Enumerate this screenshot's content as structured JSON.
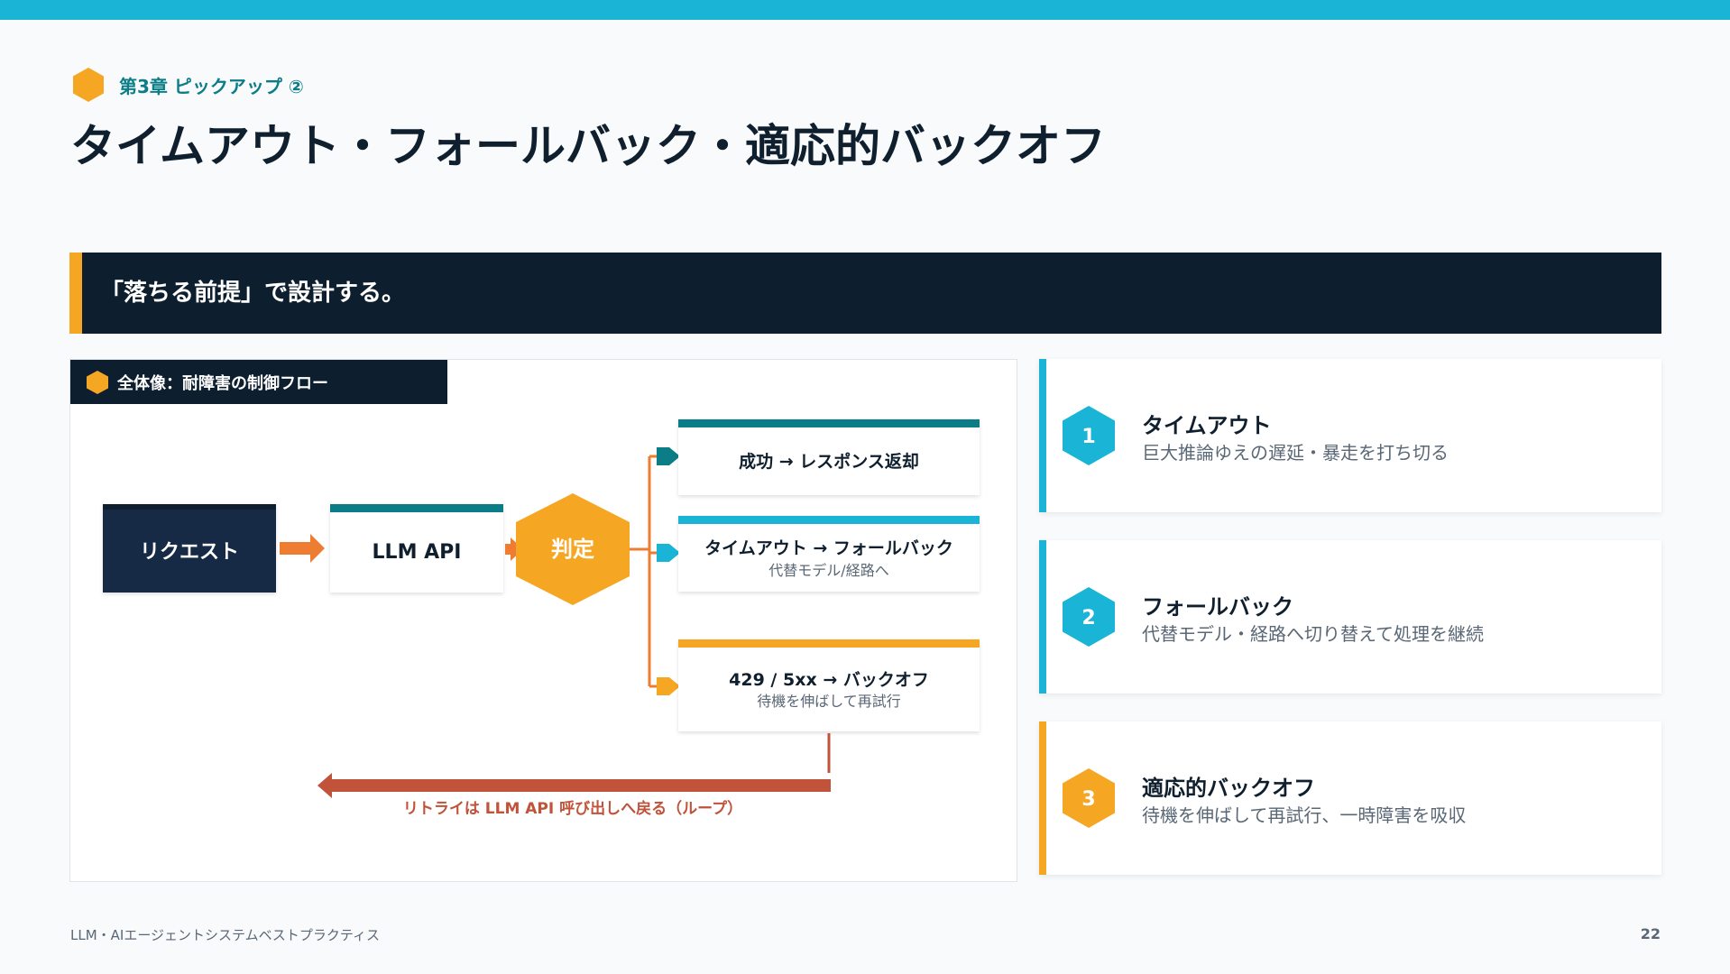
{
  "colors": {
    "teal": "#0b7d86",
    "cyan": "#1ab5d6",
    "orange": "#f5a623",
    "arrow_orange": "#ee7d32",
    "navy": "#0d1e2e",
    "loop_red": "#c0533a"
  },
  "header": {
    "chapter_icon": "hexagon-icon",
    "chapter": "第3章 ピックアップ ②",
    "title": "タイムアウト・フォールバック・適応的バックオフ"
  },
  "banner": {
    "text": "「落ちる前提」で設計する。"
  },
  "diagram": {
    "tab_icon": "hexagon-icon",
    "tab_label": "全体像：耐障害の制御フロー",
    "request": "リクエスト",
    "llm_api": "LLM API",
    "decision": "判定",
    "outcomes": [
      {
        "title": "成功 → レスポンス返却",
        "subtitle": ""
      },
      {
        "title": "タイムアウト → フォールバック",
        "subtitle": "代替モデル/経路へ"
      },
      {
        "title": "429 / 5xx → バックオフ",
        "subtitle": "待機を伸ばして再試行"
      }
    ],
    "loop_label": "リトライは LLM API 呼び出しへ戻る（ループ）"
  },
  "cards": [
    {
      "number": "1",
      "title": "タイムアウト",
      "desc": "巨大推論ゆえの遅延・暴走を打ち切る"
    },
    {
      "number": "2",
      "title": "フォールバック",
      "desc": "代替モデル・経路へ切り替えて処理を継続"
    },
    {
      "number": "3",
      "title": "適応的バックオフ",
      "desc": "待機を伸ばして再試行、一時障害を吸収"
    }
  ],
  "footer": {
    "left": "LLM・AIエージェントシステムベストプラクティス",
    "page": "22"
  }
}
